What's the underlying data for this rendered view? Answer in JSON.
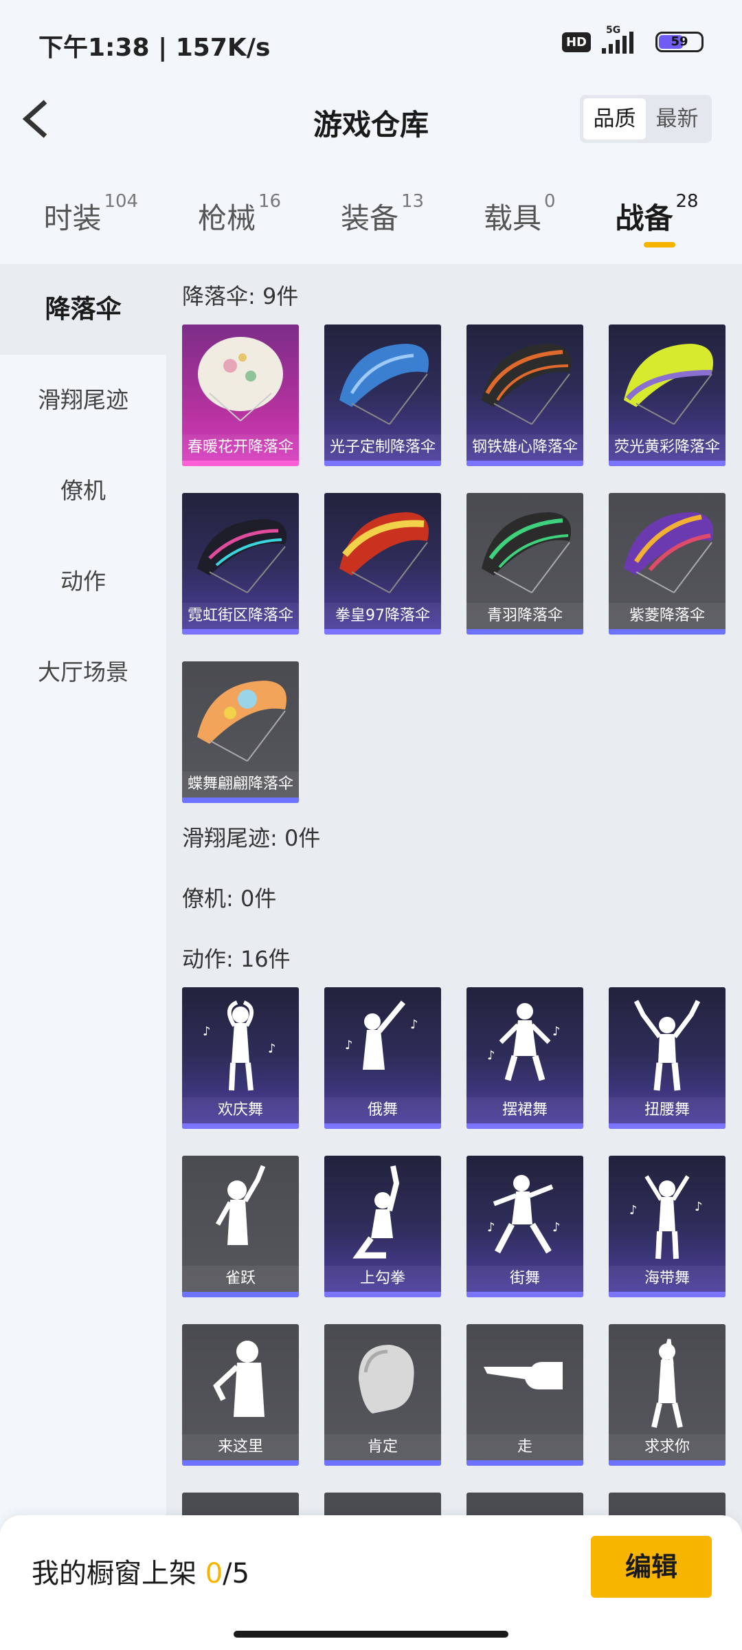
{
  "status": {
    "time": "下午1:38 | 157K/s",
    "hd": "HD",
    "network": "5G",
    "battery": "59"
  },
  "header": {
    "title": "游戏仓库",
    "sort_quality": "品质",
    "sort_newest": "最新"
  },
  "tabs": [
    {
      "label": "时装",
      "count": "104"
    },
    {
      "label": "枪械",
      "count": "16"
    },
    {
      "label": "装备",
      "count": "13"
    },
    {
      "label": "载具",
      "count": "0"
    },
    {
      "label": "战备",
      "count": "28"
    }
  ],
  "sidenav": [
    "降落伞",
    "滑翔尾迹",
    "僚机",
    "动作",
    "大厅场景"
  ],
  "sections": {
    "parachute": "降落伞: 9件",
    "glide": "滑翔尾迹: 0件",
    "wingman": "僚机: 0件",
    "emote": "动作: 16件"
  },
  "parachutes": [
    "春暖花开降落伞",
    "光子定制降落伞",
    "钢铁雄心降落伞",
    "荧光黄彩降落伞",
    "霓虹街区降落伞",
    "拳皇97降落伞",
    "青羽降落伞",
    "紫菱降落伞",
    "蝶舞翩翩降落伞"
  ],
  "emotes": [
    "俄舞",
    "摆裙舞",
    "扭腰舞",
    "欢庆舞",
    "上勾拳",
    "街舞",
    "海带舞",
    "雀跃",
    "肯定",
    "走",
    "求求你",
    "来这里"
  ],
  "bottom": {
    "showcase_label": "我的橱窗上架 ",
    "showcase_count": "0",
    "showcase_total": "/5",
    "edit": "编辑"
  },
  "colors": {
    "accent": "#f5b400",
    "rare_purple": "#2f2d5a",
    "legendary_pink": "#b4329e",
    "common_gray": "#55565c"
  }
}
